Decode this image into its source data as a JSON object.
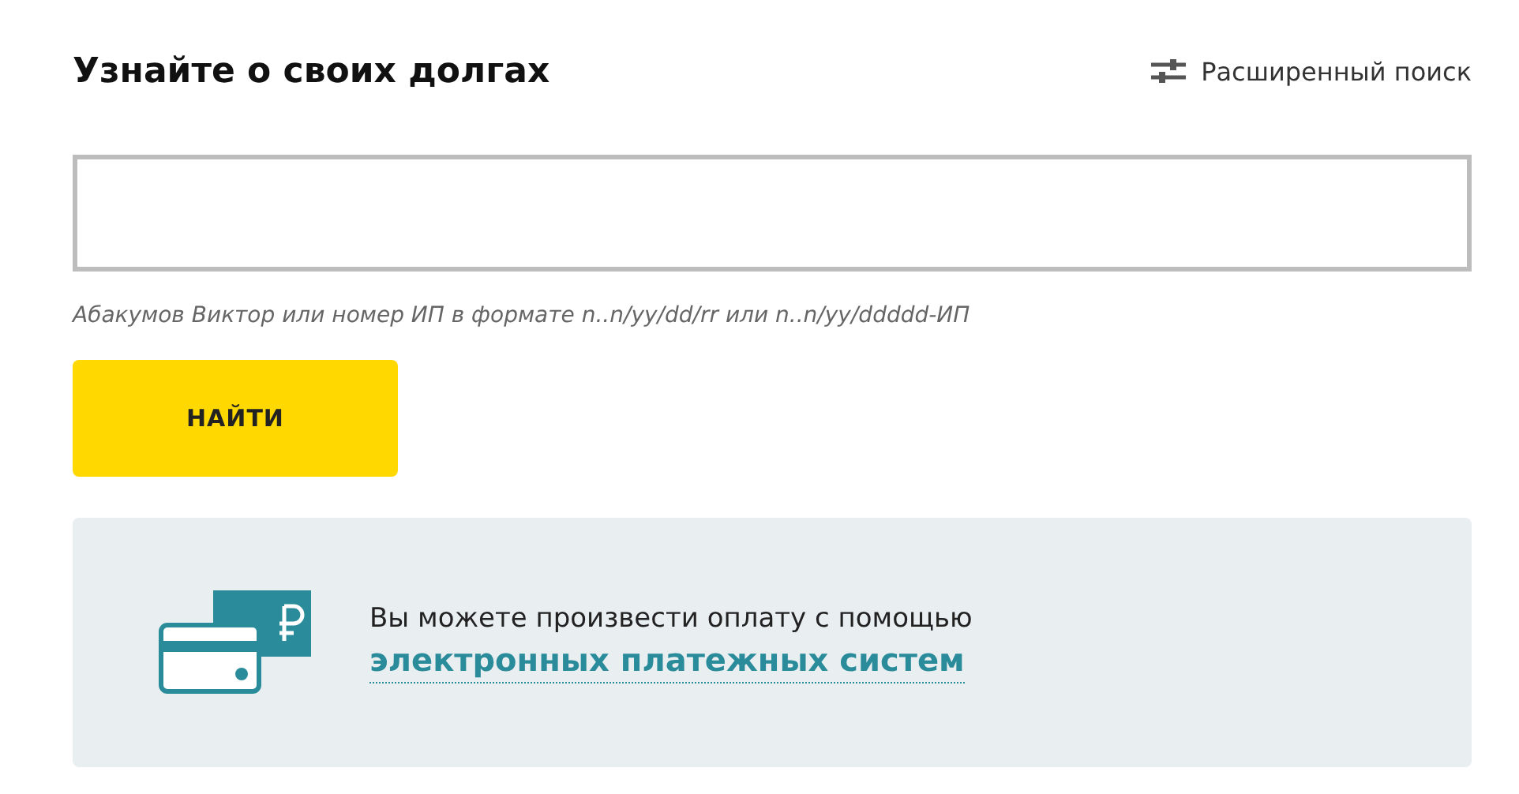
{
  "title": "Узнайте о своих долгах",
  "advanced_search": {
    "label": "Расширенный поиск"
  },
  "search": {
    "hint": "Абакумов Виктор или номер ИП в формате n..n/yy/dd/rr или n..n/yy/ddddd-ИП"
  },
  "button": {
    "label": "НАЙТИ"
  },
  "payment_info": {
    "text": "Вы можете произвести оплату с помощью",
    "link": "электронных платежных систем"
  }
}
